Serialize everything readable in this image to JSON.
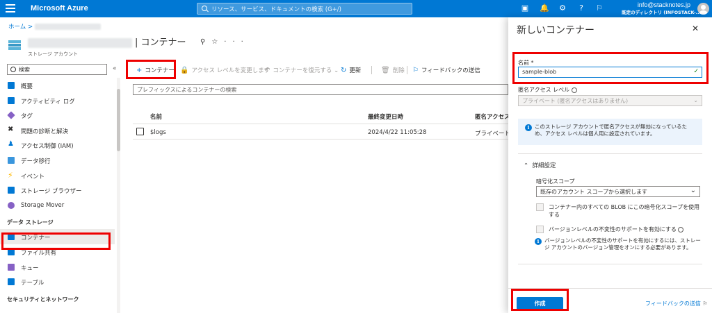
{
  "topbar": {
    "brand": "Microsoft Azure",
    "search_placeholder": "リソース、サービス、ドキュメントの検索 (G+/)",
    "account_email": "info@stacknotes.jp",
    "account_directory": "既定のディレクトリ (INFOSTACK-..."
  },
  "breadcrumb": {
    "home": "ホーム",
    "sep": ">"
  },
  "resource": {
    "title": "| コンテナー",
    "subtitle": "ストレージ アカウント",
    "more": "···"
  },
  "sidebar": {
    "search_placeholder": "検索",
    "collapse": "«",
    "items": [
      {
        "label": "概要",
        "color": "#0078d4"
      },
      {
        "label": "アクティビティ ログ",
        "color": "#0078d4"
      },
      {
        "label": "タグ",
        "color": "#8661c5"
      },
      {
        "label": "問題の診断と解決",
        "color": "#323130"
      },
      {
        "label": "アクセス制御 (IAM)",
        "color": "#0078d4"
      },
      {
        "label": "データ移行",
        "color": "#3a96dd"
      },
      {
        "label": "イベント",
        "color": "#ffb900"
      },
      {
        "label": "ストレージ ブラウザー",
        "color": "#0078d4"
      },
      {
        "label": "Storage Mover",
        "color": "#8661c5"
      }
    ],
    "section_data": "データ ストレージ",
    "data_items": [
      {
        "label": "コンテナー",
        "color": "#0078d4"
      },
      {
        "label": "ファイル共有",
        "color": "#0078d4"
      },
      {
        "label": "キュー",
        "color": "#8661c5"
      },
      {
        "label": "テーブル",
        "color": "#0078d4"
      }
    ],
    "section_security": "セキュリティとネットワーク"
  },
  "toolbar": {
    "add_container": "コンテナー",
    "change_access": "アクセス レベルを変更します",
    "restore": "コンテナーを復元する",
    "refresh": "更新",
    "delete": "削除",
    "feedback": "フィードバックの送信"
  },
  "filter_placeholder": "プレフィックスによるコンテナーの検索",
  "table": {
    "headers": [
      "名前",
      "最終変更日時",
      "匿名アクセス"
    ],
    "rows": [
      {
        "name": "$logs",
        "modified": "2024/4/22 11:05:28",
        "access": "プライベート"
      }
    ]
  },
  "panel": {
    "title": "新しいコンテナー",
    "close": "✕",
    "name_label": "名前 *",
    "name_value": "sample-blob",
    "access_label": "匿名アクセス レベル",
    "access_value": "プライベート (匿名アクセスはありません)",
    "info_text": "このストレージ アカウントで匿名アクセスが無効になっているため、アクセス レベルは個人用に設定されています。",
    "advanced": "詳細設定",
    "encryption_label": "暗号化スコープ",
    "encryption_value": "既存のアカウント スコープから選択します",
    "checkbox_scope": "コンテナー内のすべての BLOB にこの暗号化スコープを使用する",
    "checkbox_version": "バージョンレベルの不変性のサポートを有効にする",
    "version_info": "バージョンレベルの不変性のサポートを有効にするには、ストレージ アカウントのバージョン管理をオンにする必要があります。",
    "create": "作成",
    "feedback": "フィードバックの送信"
  }
}
